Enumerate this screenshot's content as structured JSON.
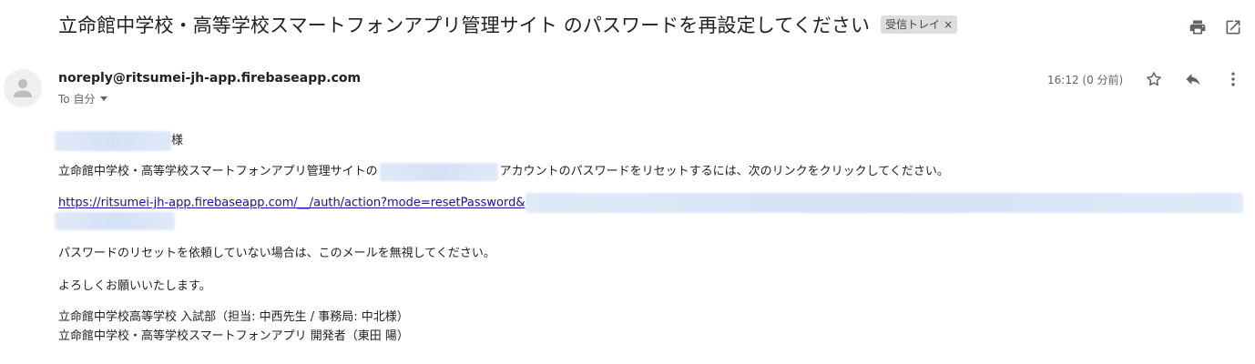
{
  "email": {
    "subject": "立命館中学校・高等学校スマートフォンアプリ管理サイト のパスワードを再設定してください",
    "label": "受信トレイ",
    "label_remove": "×",
    "sender": "noreply@ritsumei-jh-app.firebaseapp.com",
    "to_label": "To 自分",
    "timestamp": "16:12 (0 分前)",
    "body": {
      "salutation_suffix": "様",
      "line1_before": "立命館中学校・高等学校スマートフォンアプリ管理サイトの",
      "line1_after": "アカウントのパスワードをリセットするには、次のリンクをクリックしてください。",
      "link": "https://ritsumei-jh-app.firebaseapp.com/__/auth/action?mode=resetPassword&",
      "ignore_line": "パスワードのリセットを依頼していない場合は、このメールを無視してください。",
      "closing": "よろしくお願いいたします。",
      "signature1": "立命館中学校高等学校 入試部（担当: 中西先生 / 事務局: 中北様）",
      "signature2": "立命館中学校・高等学校スマートフォンアプリ 開発者（東田 陽）"
    }
  },
  "icons": {
    "print": "print-icon",
    "open_new_window": "open-in-new-icon",
    "star": "star-icon",
    "reply": "reply-icon",
    "more": "more-vert-icon",
    "avatar": "person-icon"
  },
  "colors": {
    "text": "#202124",
    "muted": "#5f6368",
    "link": "#1a0dab",
    "chip_bg": "#dddddd",
    "redaction": "#dfe9f8"
  }
}
